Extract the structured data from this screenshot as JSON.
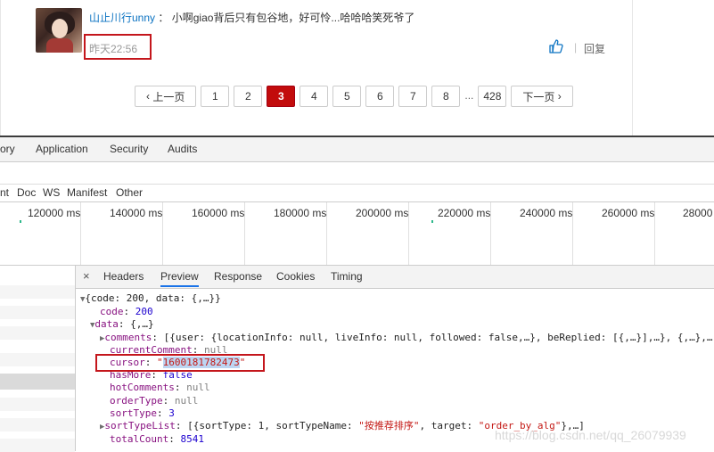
{
  "comment": {
    "username": "山止川行unny",
    "separator": "：",
    "text": "小啊giao背后只有包谷地，好可怜...哈哈哈笑死爷了",
    "timestamp": "昨天22:56",
    "divider": "|",
    "reply_label": "回复"
  },
  "pagination": {
    "prev_label": "上一页",
    "pages": [
      "1",
      "2",
      "3",
      "4",
      "5",
      "6",
      "7",
      "8"
    ],
    "active_page": "3",
    "ellipsis": "...",
    "last_page": "428",
    "next_label": "下一页"
  },
  "devtools": {
    "main_tabs": [
      "ory",
      "Application",
      "Security",
      "Audits"
    ],
    "resource_filters": [
      "nt",
      "Doc",
      "WS",
      "Manifest",
      "Other"
    ],
    "timeline_ticks": [
      "120000 ms",
      "140000 ms",
      "160000 ms",
      "180000 ms",
      "200000 ms",
      "220000 ms",
      "240000 ms",
      "260000 ms",
      "28000"
    ],
    "detail_close": "×",
    "detail_tabs": [
      "Headers",
      "Preview",
      "Response",
      "Cookies",
      "Timing"
    ],
    "active_detail_tab": "Preview",
    "preview": {
      "root_summary": "{code: 200, data: {,…}}",
      "code_key": "code",
      "code_value": "200",
      "data_key": "data",
      "data_summary": "{,…}",
      "comments_key": "comments",
      "comments_value": "[{user: {locationInfo: null, liveInfo: null, followed: false,…}, beReplied: [{,…}],…}, {,…},…",
      "currentComment_key": "currentComment",
      "currentComment_value": "null",
      "cursor_key": "cursor",
      "cursor_value": "1600181782473",
      "hasMore_key": "hasMore",
      "hasMore_value": "false",
      "hotComments_key": "hotComments",
      "hotComments_value": "null",
      "orderType_key": "orderType",
      "orderType_value": "null",
      "sortType_key": "sortType",
      "sortType_value": "3",
      "sortTypeList_key": "sortTypeList",
      "sortTypeList_value_prefix": "[{sortType: 1, sortTypeName: ",
      "sortTypeList_name": "\"按推荐排序\"",
      "sortTypeList_value_mid": ", target: ",
      "sortTypeList_target": "\"order_by_alg\"",
      "sortTypeList_value_suffix": "},…]",
      "totalCount_key": "totalCount",
      "totalCount_value": "8541"
    },
    "watermark": "https://blog.csdn.net/qq_26079939"
  },
  "colors": {
    "highlight_box": "#c4161c",
    "active_page": "#c20c0c",
    "username_link": "#0c73c2"
  }
}
